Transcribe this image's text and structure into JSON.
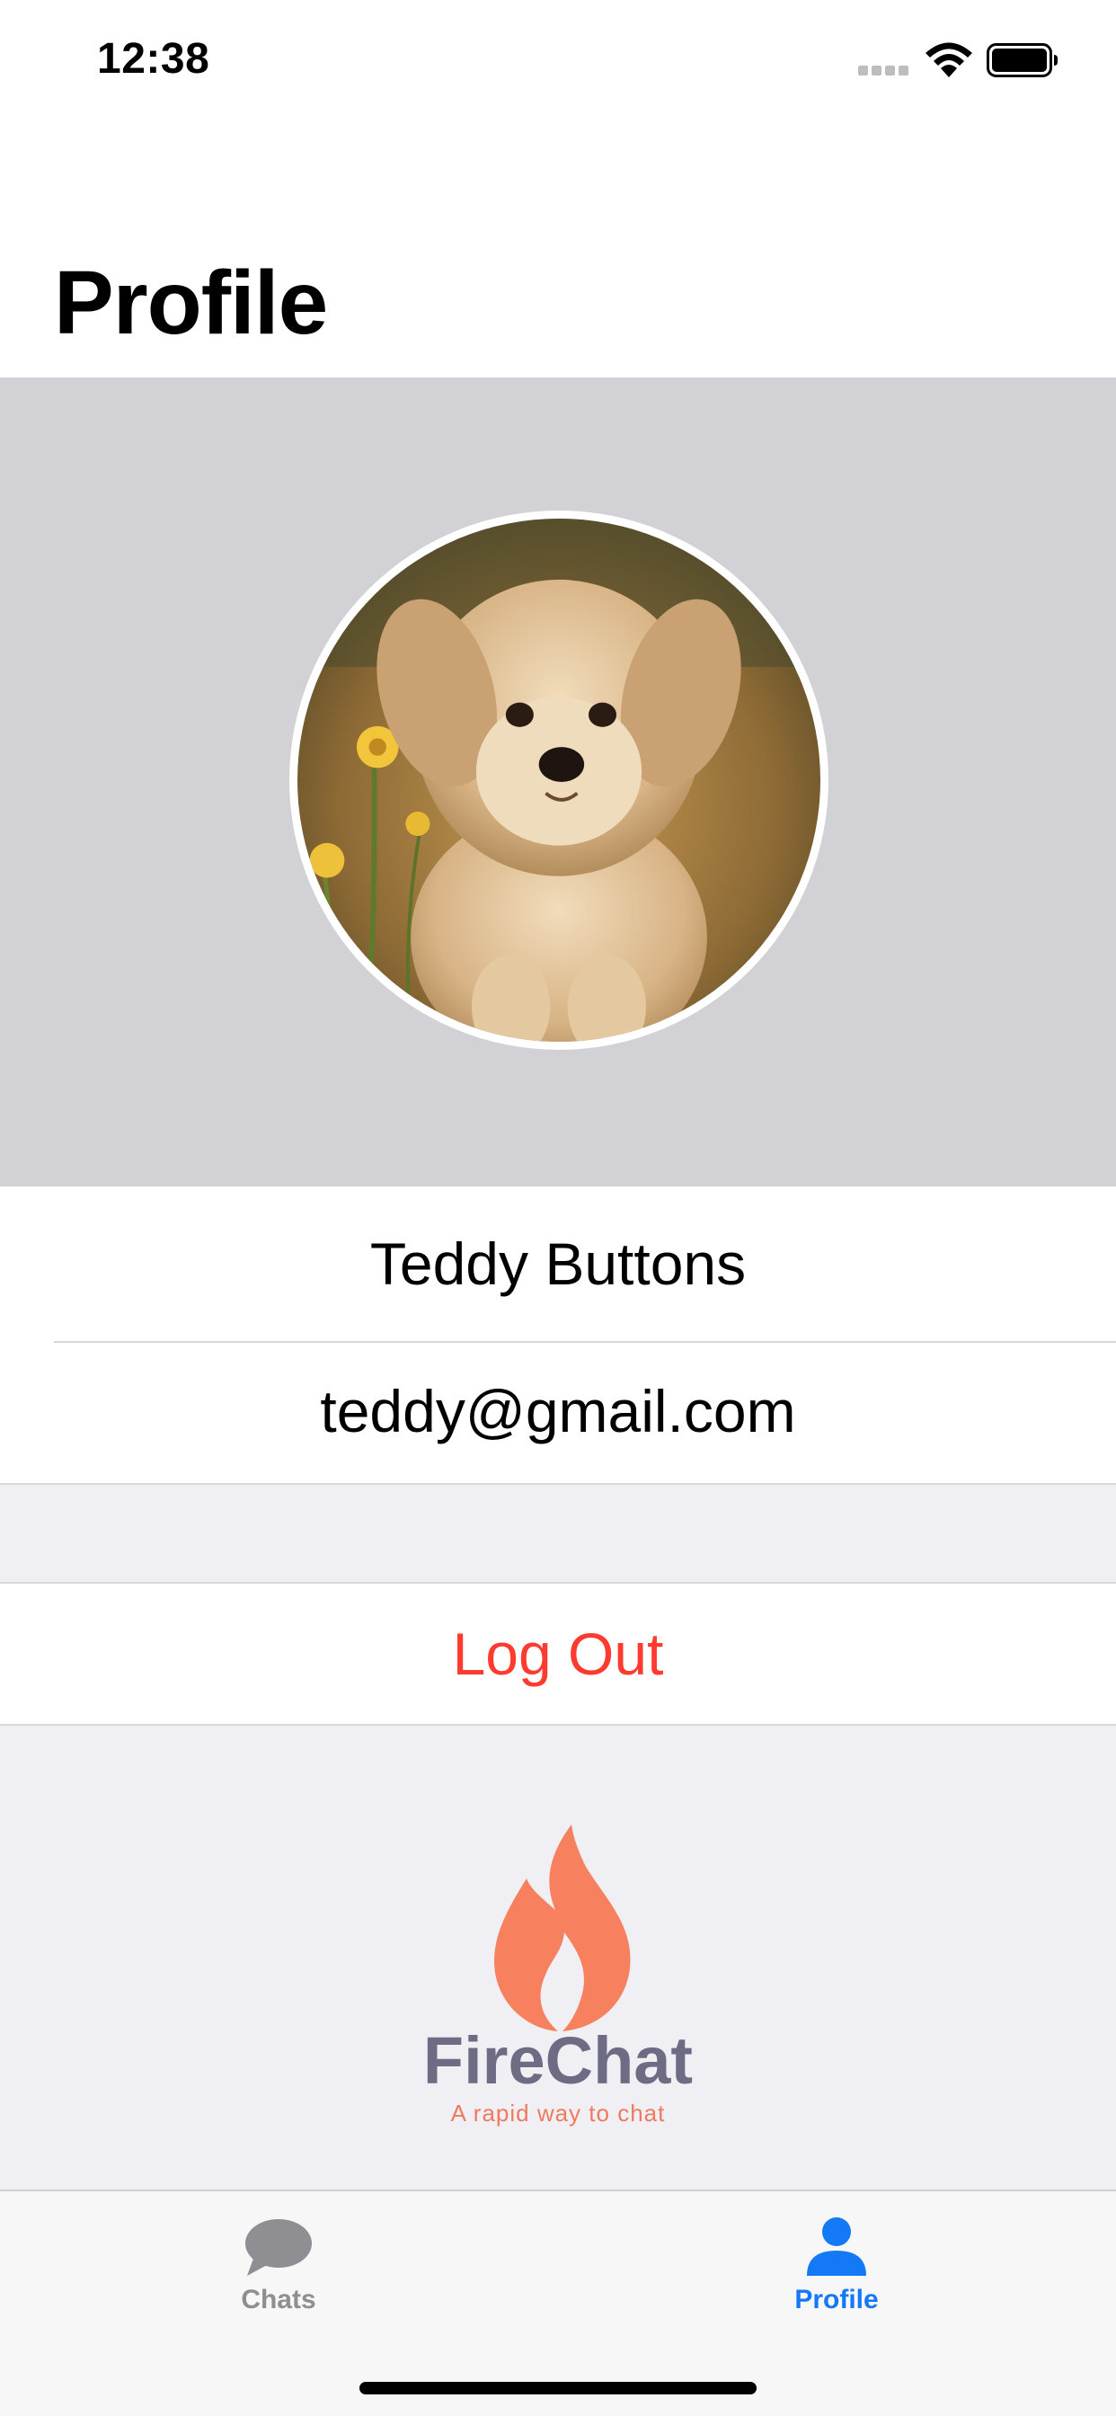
{
  "status_bar": {
    "time": "12:38"
  },
  "header": {
    "title": "Profile"
  },
  "profile": {
    "name": "Teddy Buttons",
    "email": "teddy@gmail.com"
  },
  "actions": {
    "logout_label": "Log Out"
  },
  "logo": {
    "name": "FireChat",
    "tagline": "A rapid way to chat"
  },
  "tab_bar": {
    "tabs": [
      {
        "label": "Chats",
        "icon": "speech-bubble-icon",
        "selected": false
      },
      {
        "label": "Profile",
        "icon": "person-icon",
        "selected": true
      }
    ]
  },
  "colors": {
    "accent": "#1479f6",
    "destructive": "#ff3b30",
    "flame": "#f7805e",
    "logo_text": "#6e6b84",
    "avatar_background": "#d1d1d6"
  }
}
